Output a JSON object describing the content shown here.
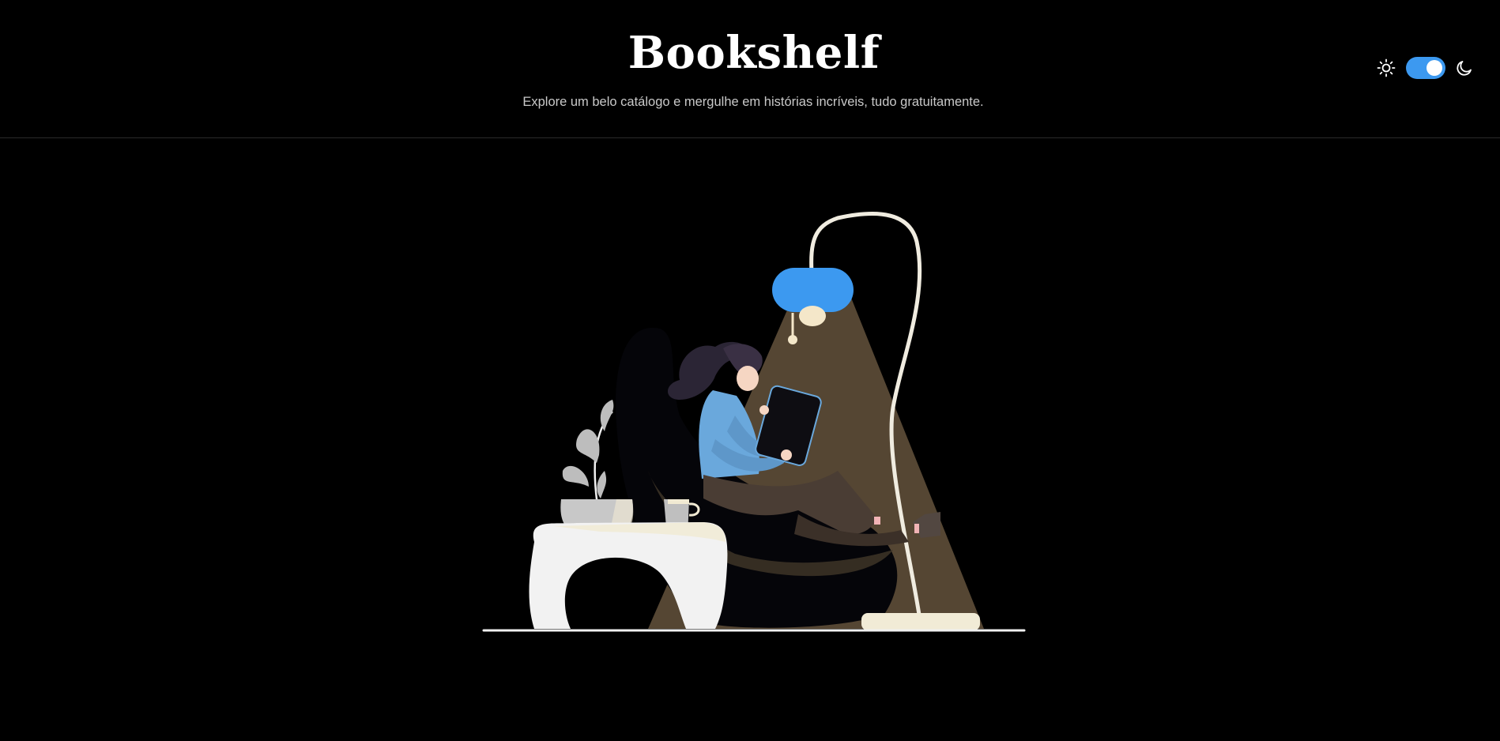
{
  "header": {
    "title": "Bookshelf",
    "subtitle": "Explore um belo catálogo e mergulhe em histórias incríveis, tudo gratuitamente."
  },
  "theme_switch": {
    "mode": "dark",
    "enabled": true,
    "light_icon": "sun-icon",
    "dark_icon": "moon-icon",
    "accent": "#3c99f0"
  },
  "illustration": {
    "subject": "reading-woman-under-floor-lamp",
    "colors": {
      "background": "#000000",
      "lamp_shade": "#3c99f0",
      "light_cone": "#5a4a36",
      "shirt": "#6aa8dc",
      "furniture": "#f2f2f2"
    }
  }
}
